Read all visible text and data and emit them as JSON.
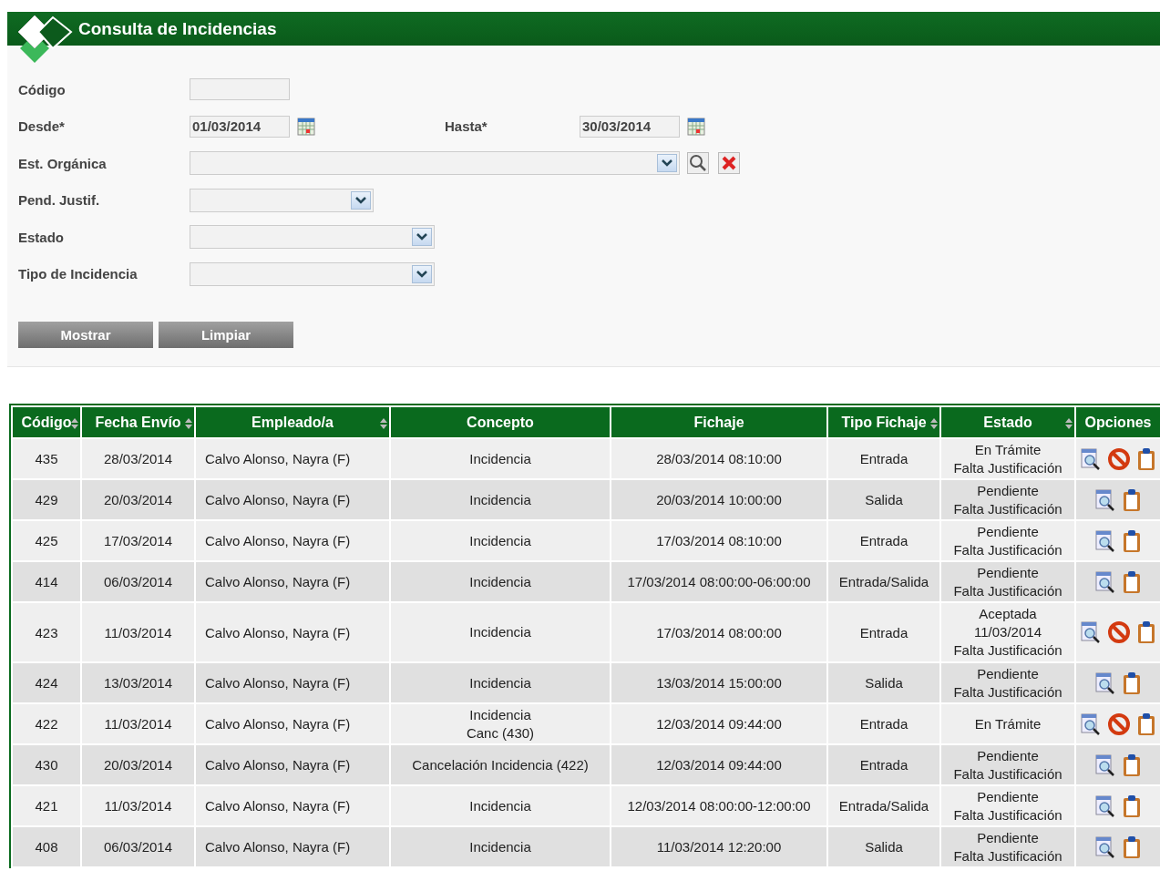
{
  "title": "Consulta de Incidencias",
  "form": {
    "codigo": {
      "label": "Código"
    },
    "desde": {
      "label": "Desde*",
      "value": "01/03/2014"
    },
    "hasta": {
      "label": "Hasta*",
      "value": "30/03/2014"
    },
    "organica": {
      "label": "Est. Orgánica"
    },
    "selects": [
      {
        "label": "Pend. Justif."
      },
      {
        "label": "Estado"
      },
      {
        "label": "Tipo de Incidencia"
      }
    ]
  },
  "buttons": [
    "Mostrar",
    "Limpiar"
  ],
  "table": {
    "columns": [
      {
        "label": "Código",
        "sortable": true
      },
      {
        "label": "Fecha Envío",
        "sortable": true
      },
      {
        "label": "Empleado/a",
        "sortable": true
      },
      {
        "label": "Concepto",
        "sortable": false
      },
      {
        "label": "Fichaje",
        "sortable": false
      },
      {
        "label": "Tipo Fichaje",
        "sortable": true
      },
      {
        "label": "Estado",
        "sortable": true
      },
      {
        "label": "Opciones",
        "sortable": false
      }
    ],
    "rows": [
      {
        "codigo": "435",
        "fecha": "28/03/2014",
        "empleado": "Calvo Alonso, Nayra (F)",
        "concepto": [
          "Incidencia"
        ],
        "fichaje": "28/03/2014 08:10:00",
        "tipo": "Entrada",
        "estado": [
          "En Trámite",
          "Falta Justificación"
        ],
        "cancel": true
      },
      {
        "codigo": "429",
        "fecha": "20/03/2014",
        "empleado": "Calvo Alonso, Nayra (F)",
        "concepto": [
          "Incidencia"
        ],
        "fichaje": "20/03/2014 10:00:00",
        "tipo": "Salida",
        "estado": [
          "Pendiente",
          "Falta Justificación"
        ],
        "cancel": false
      },
      {
        "codigo": "425",
        "fecha": "17/03/2014",
        "empleado": "Calvo Alonso, Nayra (F)",
        "concepto": [
          "Incidencia"
        ],
        "fichaje": "17/03/2014 08:10:00",
        "tipo": "Entrada",
        "estado": [
          "Pendiente",
          "Falta Justificación"
        ],
        "cancel": false
      },
      {
        "codigo": "414",
        "fecha": "06/03/2014",
        "empleado": "Calvo Alonso, Nayra (F)",
        "concepto": [
          "Incidencia"
        ],
        "fichaje": "17/03/2014 08:00:00-06:00:00",
        "tipo": "Entrada/Salida",
        "estado": [
          "Pendiente",
          "Falta Justificación"
        ],
        "cancel": false
      },
      {
        "codigo": "423",
        "fecha": "11/03/2014",
        "empleado": "Calvo Alonso, Nayra (F)",
        "concepto": [
          "Incidencia"
        ],
        "fichaje": "17/03/2014 08:00:00",
        "tipo": "Entrada",
        "estado": [
          "Aceptada",
          "11/03/2014",
          "Falta Justificación"
        ],
        "cancel": true
      },
      {
        "codigo": "424",
        "fecha": "13/03/2014",
        "empleado": "Calvo Alonso, Nayra (F)",
        "concepto": [
          "Incidencia"
        ],
        "fichaje": "13/03/2014 15:00:00",
        "tipo": "Salida",
        "estado": [
          "Pendiente",
          "Falta Justificación"
        ],
        "cancel": false
      },
      {
        "codigo": "422",
        "fecha": "11/03/2014",
        "empleado": "Calvo Alonso, Nayra (F)",
        "concepto": [
          "Incidencia",
          "Canc (430)"
        ],
        "fichaje": "12/03/2014 09:44:00",
        "tipo": "Entrada",
        "estado": [
          "En Trámite"
        ],
        "cancel": true
      },
      {
        "codigo": "430",
        "fecha": "20/03/2014",
        "empleado": "Calvo Alonso, Nayra (F)",
        "concepto": [
          "Cancelación Incidencia (422)"
        ],
        "fichaje": "12/03/2014 09:44:00",
        "tipo": "Entrada",
        "estado": [
          "Pendiente",
          "Falta Justificación"
        ],
        "cancel": false
      },
      {
        "codigo": "421",
        "fecha": "11/03/2014",
        "empleado": "Calvo Alonso, Nayra (F)",
        "concepto": [
          "Incidencia"
        ],
        "fichaje": "12/03/2014 08:00:00-12:00:00",
        "tipo": "Entrada/Salida",
        "estado": [
          "Pendiente",
          "Falta Justificación"
        ],
        "cancel": false
      },
      {
        "codigo": "408",
        "fecha": "06/03/2014",
        "empleado": "Calvo Alonso, Nayra (F)",
        "concepto": [
          "Incidencia"
        ],
        "fichaje": "11/03/2014 12:20:00",
        "tipo": "Salida",
        "estado": [
          "Pendiente",
          "Falta Justificación"
        ],
        "cancel": false
      }
    ]
  }
}
